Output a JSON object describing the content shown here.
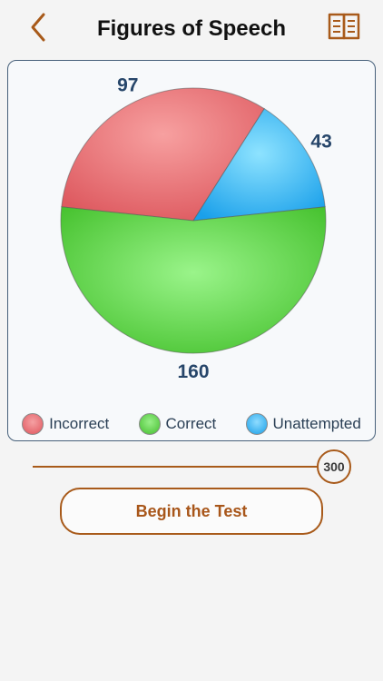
{
  "header": {
    "title": "Figures of Speech",
    "back_icon": "chevron-left-icon",
    "book_icon": "book-icon"
  },
  "colors": {
    "accent": "#a85a1a",
    "incorrect": "#e86a6e",
    "correct": "#52c43a",
    "unattempted": "#2aaaf0"
  },
  "chart_data": {
    "type": "pie",
    "slices": [
      {
        "name": "Incorrect",
        "value": 97,
        "color": "#e86a6e"
      },
      {
        "name": "Unattempted",
        "value": 43,
        "color": "#2aaaf0"
      },
      {
        "name": "Correct",
        "value": 160,
        "color": "#52c43a"
      }
    ],
    "legend": [
      "Incorrect",
      "Correct",
      "Unattempted"
    ],
    "legend_position": "bottom"
  },
  "slider": {
    "value": "300"
  },
  "begin_button": {
    "label": "Begin the Test"
  }
}
